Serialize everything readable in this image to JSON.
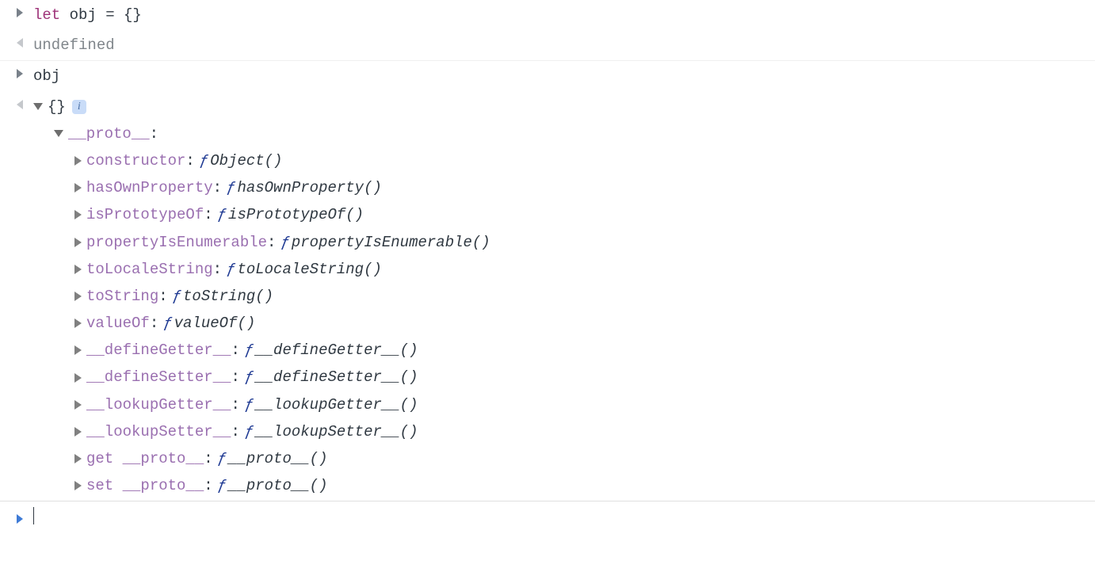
{
  "rows": {
    "input1": {
      "keyword": "let",
      "rest": " obj = {}"
    },
    "output1": "undefined",
    "input2": "obj"
  },
  "tree": {
    "root": "{}",
    "proto_label": "__proto__",
    "colon": ":",
    "fsymbol": "ƒ",
    "members": [
      {
        "name": "constructor",
        "fn": "Object()"
      },
      {
        "name": "hasOwnProperty",
        "fn": "hasOwnProperty()"
      },
      {
        "name": "isPrototypeOf",
        "fn": "isPrototypeOf()"
      },
      {
        "name": "propertyIsEnumerable",
        "fn": "propertyIsEnumerable()"
      },
      {
        "name": "toLocaleString",
        "fn": "toLocaleString()"
      },
      {
        "name": "toString",
        "fn": "toString()"
      },
      {
        "name": "valueOf",
        "fn": "valueOf()"
      },
      {
        "name": "__defineGetter__",
        "fn": "__defineGetter__()"
      },
      {
        "name": "__defineSetter__",
        "fn": "__defineSetter__()"
      },
      {
        "name": "__lookupGetter__",
        "fn": "__lookupGetter__()"
      },
      {
        "name": "__lookupSetter__",
        "fn": "__lookupSetter__()"
      },
      {
        "name": "get __proto__",
        "fn": "__proto__()"
      },
      {
        "name": "set __proto__",
        "fn": "__proto__()"
      }
    ]
  },
  "info_badge": "i"
}
